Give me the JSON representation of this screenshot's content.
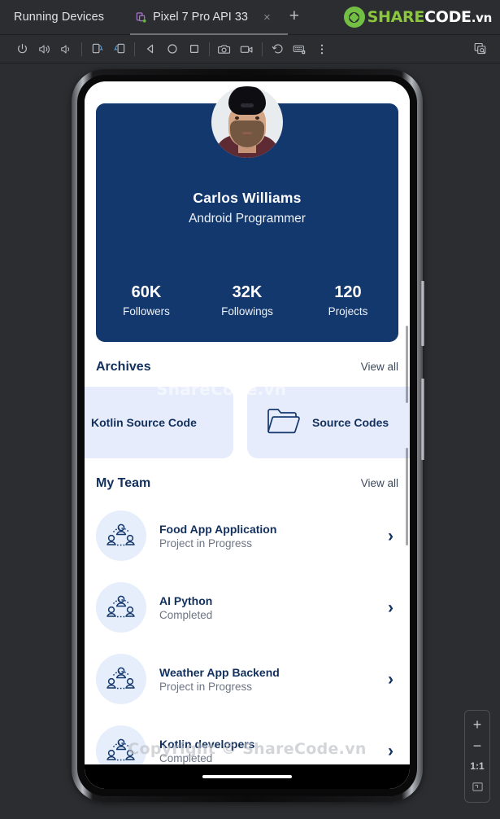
{
  "ide": {
    "tool_window_title": "Running Devices",
    "tab": {
      "label": "Pixel 7 Pro API 33",
      "close_label": "×",
      "add_label": "+",
      "device_icon": "device-phone-icon"
    },
    "brand": {
      "text_share": "SHARE",
      "text_code": "CODE",
      "text_tld": ".vn",
      "mark_icon": "sharecode-logo-icon"
    },
    "toolbar": [
      {
        "name": "power-button",
        "icon": "power-icon"
      },
      {
        "name": "volume-up-button",
        "icon": "volume-up-icon"
      },
      {
        "name": "volume-down-button",
        "icon": "volume-down-icon"
      },
      {
        "name": "rotate-left-button",
        "icon": "rotate-left-icon"
      },
      {
        "name": "rotate-right-button",
        "icon": "rotate-right-icon"
      },
      {
        "name": "back-button",
        "icon": "triangle-back-icon"
      },
      {
        "name": "home-button",
        "icon": "circle-home-icon"
      },
      {
        "name": "overview-button",
        "icon": "square-overview-icon"
      },
      {
        "name": "screenshot-button",
        "icon": "camera-icon"
      },
      {
        "name": "record-screen-button",
        "icon": "video-camera-icon"
      },
      {
        "name": "device-history-button",
        "icon": "history-rewind-icon"
      },
      {
        "name": "hardware-input-button",
        "icon": "keyboard-icon"
      },
      {
        "name": "more-options-button",
        "icon": "kebab-menu-icon"
      },
      {
        "name": "ui-inspector-button",
        "icon": "layout-inspect-icon"
      }
    ],
    "zoom_controls": {
      "zoom_in": "+",
      "zoom_out": "−",
      "actual_size": "1:1",
      "fit_to_window_icon": "fit-screen-icon"
    }
  },
  "app": {
    "profile": {
      "avatar_icon": "user-photo-avatar",
      "name": "Carlos Williams",
      "role": "Android Programmer",
      "stats": [
        {
          "value": "60K",
          "label": "Followers"
        },
        {
          "value": "32K",
          "label": "Followings"
        },
        {
          "value": "120",
          "label": "Projects"
        }
      ]
    },
    "archives": {
      "title": "Archives",
      "view_all": "View all",
      "cards": [
        {
          "label": "Kotlin Source Code",
          "icon": "folder-icon"
        },
        {
          "label": "Source Codes",
          "icon": "folder-icon"
        }
      ]
    },
    "my_team": {
      "title": "My Team",
      "view_all": "View all",
      "items": [
        {
          "title": "Food App Application",
          "status": "Project in Progress",
          "icon": "team-group-icon",
          "chevron": "›"
        },
        {
          "title": "AI Python",
          "status": "Completed",
          "icon": "team-group-icon",
          "chevron": "›"
        },
        {
          "title": "Weather App Backend",
          "status": "Project in Progress",
          "icon": "team-group-icon",
          "chevron": "›"
        },
        {
          "title": "Kotlin developers",
          "status": "Completed",
          "icon": "team-group-icon",
          "chevron": "›"
        }
      ]
    }
  },
  "watermarks": {
    "middle": "ShareCode.vn",
    "bottom": "Copyright © ShareCode.vn"
  },
  "colors": {
    "ide_background": "#2b2d30",
    "profile_card_blue": "#13386d",
    "accent_navy": "#12305d",
    "card_light_blue": "#e6ecfb",
    "brand_green": "#8cc63f"
  }
}
